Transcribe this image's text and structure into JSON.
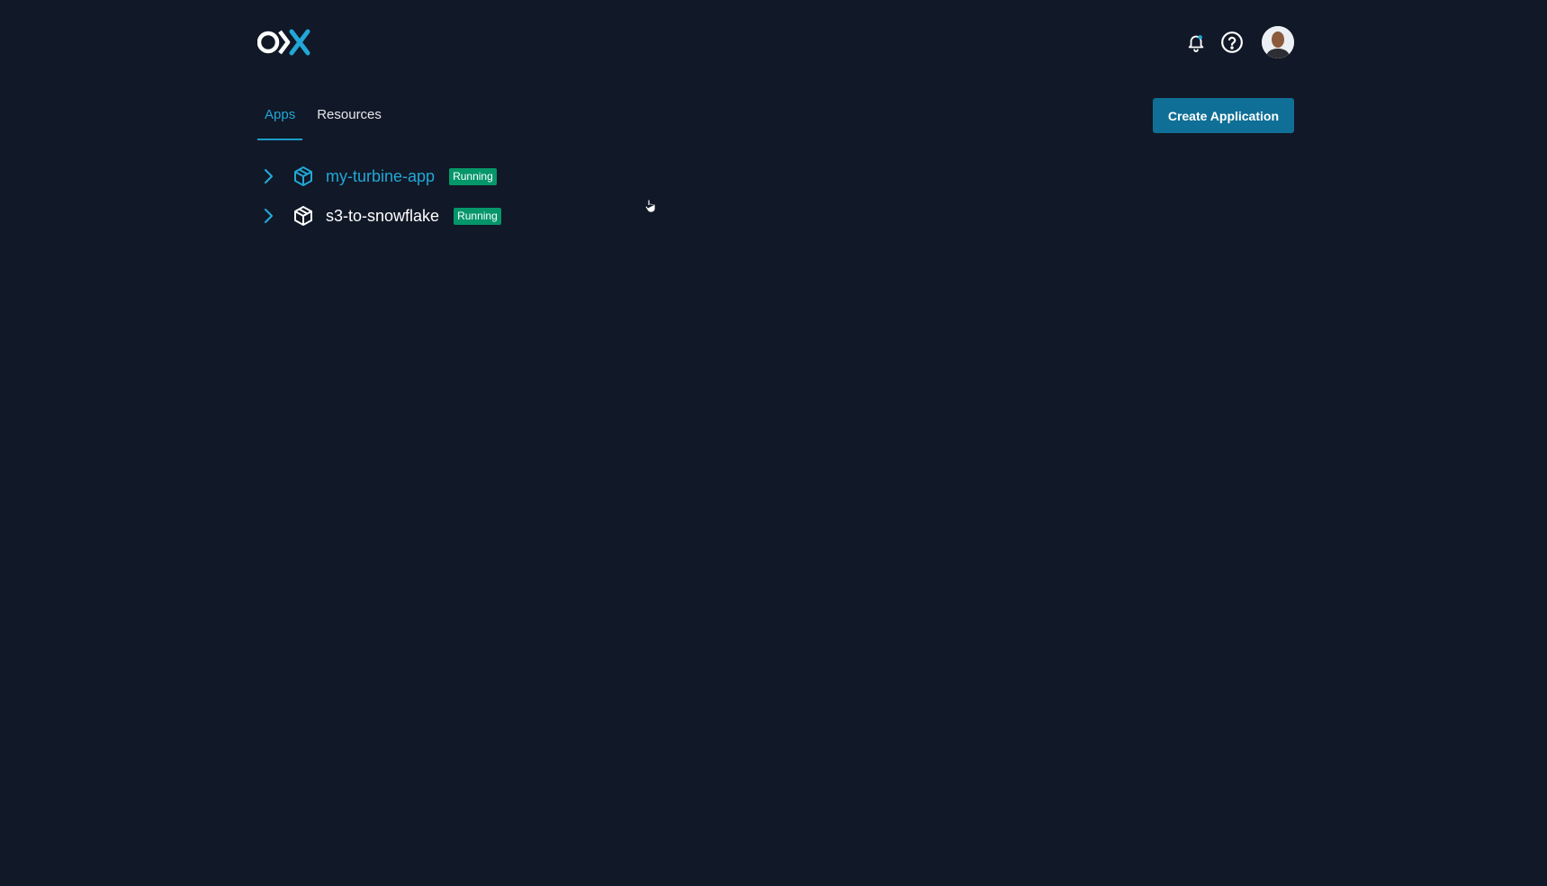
{
  "brand": {
    "logo_icon": "ox-logo",
    "accent_color": "#22a7d6"
  },
  "header": {
    "notifications_icon": "bell-icon",
    "help_icon": "help-circle-icon",
    "avatar_icon": "user-avatar"
  },
  "tabs": [
    {
      "label": "Apps",
      "active": true
    },
    {
      "label": "Resources",
      "active": false
    }
  ],
  "actions": {
    "create_label": "Create Application"
  },
  "apps": [
    {
      "name": "my-turbine-app",
      "status": "Running"
    },
    {
      "name": "s3-to-snowflake",
      "status": "Running"
    }
  ],
  "colors": {
    "background": "#111827",
    "running_badge": "#059669",
    "primary_button": "#106f96"
  }
}
